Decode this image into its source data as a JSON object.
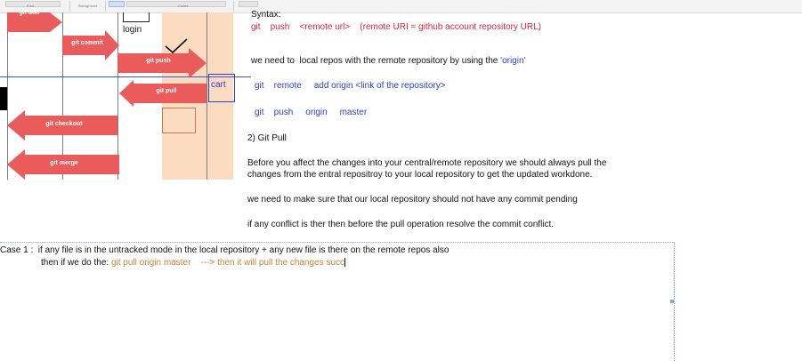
{
  "ribbon": {
    "groups": [
      "Font",
      "Background",
      "Colors"
    ]
  },
  "diagram": {
    "login_label": "login",
    "cart_label": "cart",
    "arrows": {
      "git_add": "git add",
      "git_commit": "git commit",
      "git_push": "git push",
      "git_pull": "git pull",
      "git_checkout": "git checkout",
      "git_merge": "git merge"
    },
    "colors": {
      "arrow": "#ea5c5c",
      "band": "#fbdcc0",
      "cart_border": "#2b3fc7"
    }
  },
  "notes": {
    "syntax_heading": "Syntax:",
    "push_syntax": "git    push    <remote url>    (remote URI = github account repository URL)",
    "remote_intro_before": "we need to  local repos with the remote repository by using the ",
    "remote_intro_origin": "'origin'",
    "remote_add_cmd": "git    remote     add origin <link of the repository>",
    "push_origin_cmd": "git    push     origin     master",
    "git_pull_heading": "2) Git Pull",
    "pull_para_line1": "Before you affect the changes into your central/remote repository we should always pull the",
    "pull_para_line2": "changes from the entral repositroy to your local repository to get the updated workdone.",
    "no_commit_pending": "we need to make sure that our local repository should not have any commit pending",
    "conflict_note": "if any conflict is ther then before the pull operation resolve the commit conflict.",
    "case1_line1": "Case 1 :  if any file is in the untracked mode in the local repository + any new file is there on the remote repos also",
    "case1_line2_prefix": "then if we do the: ",
    "case1_line2_cmd": "git pull origin master    ---> then it will pull the changes succ"
  }
}
